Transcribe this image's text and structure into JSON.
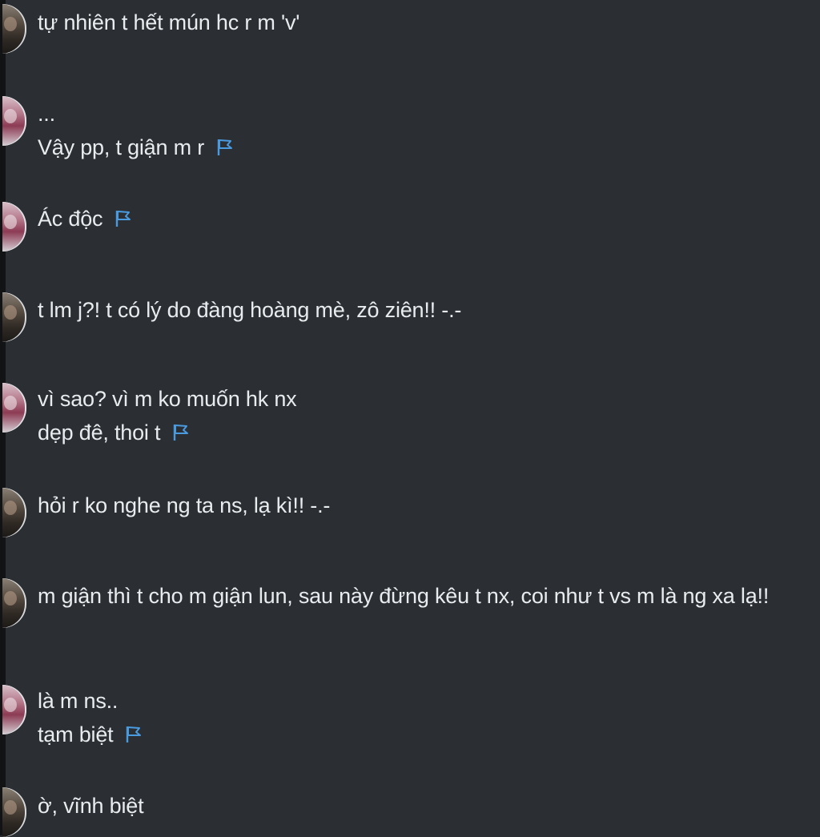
{
  "messages": [
    {
      "sender": "boy",
      "lines": [
        "tự nhiên t hết mún hc r m 'v'"
      ],
      "flagged": false
    },
    {
      "sender": "girl",
      "lines": [
        "...",
        "Vậy pp, t giận m r"
      ],
      "flagged": true
    },
    {
      "sender": "girl",
      "lines": [
        "Ác độc"
      ],
      "flagged": true
    },
    {
      "sender": "boy",
      "lines": [
        "t lm j?! t có lý do đàng hoàng mè, zô ziên!! -.-"
      ],
      "flagged": false
    },
    {
      "sender": "girl",
      "lines": [
        "vì sao? vì m ko muốn hk nx",
        "dẹp đê, thoi t"
      ],
      "flagged": true
    },
    {
      "sender": "boy",
      "lines": [
        "hỏi r ko nghe ng ta ns, lạ kì!! -.-"
      ],
      "flagged": false
    },
    {
      "sender": "boy",
      "lines": [
        "m giận thì t cho m giận lun, sau này đừng kêu t nx, coi như t vs m là ng xa lạ!!"
      ],
      "flagged": false
    },
    {
      "sender": "girl",
      "lines": [
        "là m ns..",
        "tạm biệt"
      ],
      "flagged": true
    },
    {
      "sender": "boy",
      "lines": [
        "ờ, vĩnh biệt"
      ],
      "flagged": false
    }
  ],
  "icons": {
    "flag": "flag-icon",
    "avatar_boy": "avatar-boy",
    "avatar_girl": "avatar-girl"
  },
  "colors": {
    "background": "#2b2f33",
    "text": "#e9ecef",
    "flag": "#4a9ae0"
  }
}
